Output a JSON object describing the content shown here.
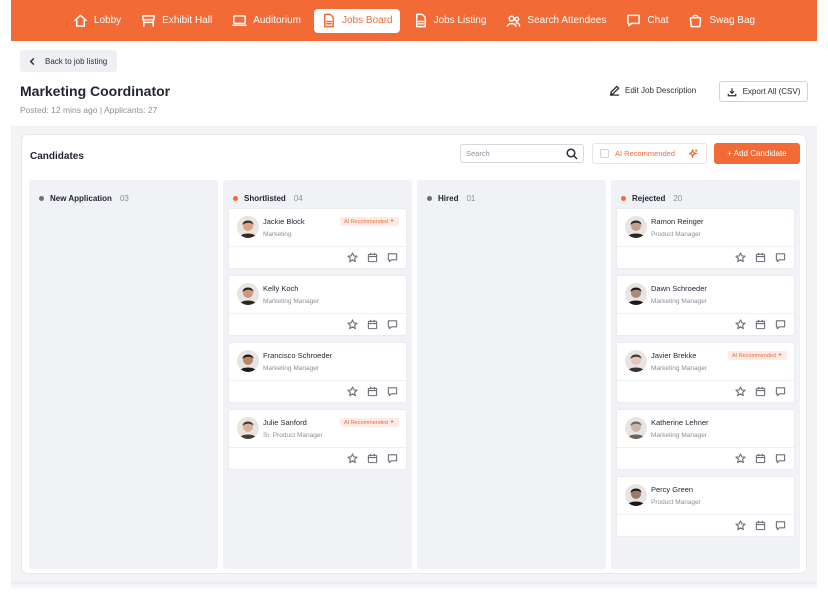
{
  "nav": {
    "items": [
      {
        "label": "Lobby",
        "icon": "home-icon",
        "active": false
      },
      {
        "label": "Exhibit Hall",
        "icon": "booth-icon",
        "active": false
      },
      {
        "label": "Auditorium",
        "icon": "monitor-icon",
        "active": false
      },
      {
        "label": "Jobs Board",
        "icon": "document-icon",
        "active": true
      },
      {
        "label": "Jobs Listing",
        "icon": "document-icon",
        "active": false
      },
      {
        "label": "Search Attendees",
        "icon": "people-icon",
        "active": false
      },
      {
        "label": "Chat",
        "icon": "chat-icon",
        "active": false
      },
      {
        "label": "Swag Bag",
        "icon": "bag-icon",
        "active": false
      }
    ]
  },
  "header": {
    "back_label": "Back to job listing",
    "title": "Marketing Coordinator",
    "meta": "Posted: 12 mins ago  |  Applicants: 27",
    "edit_label": "Edit Job Description",
    "export_label": "Export All (CSV)"
  },
  "board": {
    "title": "Candidates",
    "search_placeholder": "Search",
    "ai_filter_label": "AI Recommended",
    "add_label": "+ Add Candidate",
    "ai_badge_label": "AI Recommended",
    "accent": "#f26a35",
    "columns": [
      {
        "name": "New Application",
        "count": "03",
        "dot_color": "#6b7079",
        "cards": []
      },
      {
        "name": "Shortlisted",
        "count": "04",
        "dot_color": "#f26a35",
        "cards": [
          {
            "name": "Jackie Block",
            "role": "Marketing",
            "ai": true
          },
          {
            "name": "Kelly Koch",
            "role": "Marketing Manager",
            "ai": false
          },
          {
            "name": "Francisco Schroeder",
            "role": "Marketing Manager",
            "ai": false
          },
          {
            "name": "Julie Sanford",
            "role": "Sr. Product Manager",
            "ai": true
          }
        ]
      },
      {
        "name": "Hired",
        "count": "01",
        "dot_color": "#6b7079",
        "cards": []
      },
      {
        "name": "Rejected",
        "count": "20",
        "dot_color": "#f26a35",
        "cards": [
          {
            "name": "Ramon Reinger",
            "role": "Product Manager",
            "ai": false
          },
          {
            "name": "Dawn Schroeder",
            "role": "Marketing Manager",
            "ai": false
          },
          {
            "name": "Javier Brekke",
            "role": "Marketing Manager",
            "ai": true
          },
          {
            "name": "Katherine Lehner",
            "role": "Marketing Manager",
            "ai": false
          },
          {
            "name": "Percy Green",
            "role": "Product Manager",
            "ai": false
          }
        ]
      }
    ]
  }
}
